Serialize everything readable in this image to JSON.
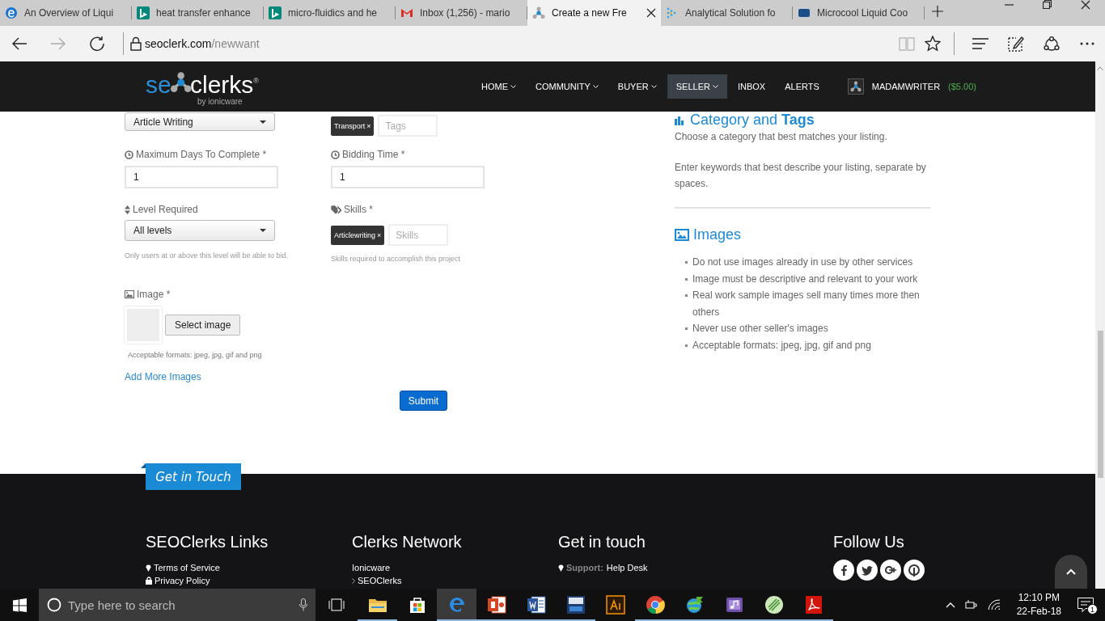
{
  "browser": {
    "tabs": [
      {
        "title": "An Overview of Liqui",
        "selected": false
      },
      {
        "title": "heat transfer enhance",
        "selected": false
      },
      {
        "title": "micro-fluidics and he",
        "selected": false
      },
      {
        "title": "Inbox (1,256) - mario",
        "selected": false
      },
      {
        "title": "Create a new Fre",
        "selected": true
      },
      {
        "title": "Analytical Solution fo",
        "selected": false
      },
      {
        "title": "Microcool Liquid Coo",
        "selected": false
      }
    ],
    "address": {
      "host": "seoclerk.com",
      "path": "/newwant"
    }
  },
  "site_nav": {
    "logo": {
      "lead": "se",
      "rest": "clerks",
      "mark": "®",
      "tagline": "by ionicware"
    },
    "items": [
      {
        "label": "HOME",
        "has_menu": true,
        "selected": false
      },
      {
        "label": "COMMUNITY",
        "has_menu": true,
        "selected": false
      },
      {
        "label": "BUYER",
        "has_menu": true,
        "selected": false
      },
      {
        "label": "SELLER",
        "has_menu": true,
        "selected": true
      },
      {
        "label": "INBOX",
        "has_menu": false,
        "selected": false
      },
      {
        "label": "ALERTS",
        "has_menu": false,
        "selected": false
      }
    ],
    "user": {
      "name": "MADAMWRITER",
      "balance": "($5.00)"
    }
  },
  "form": {
    "category": {
      "value": "Article Writing"
    },
    "tags": {
      "chips": [
        {
          "label": "Transport",
          "remove": "×"
        }
      ],
      "placeholder": "Tags"
    },
    "max_days": {
      "label": "Maximum Days To Complete *",
      "value": "1"
    },
    "bidding_time": {
      "label": "Bidding Time *",
      "value": "1"
    },
    "level": {
      "label": "Level Required",
      "value": "All levels",
      "help": "Only users at or above this level will be able to bid."
    },
    "skills": {
      "label": "Skills *",
      "chips": [
        {
          "label": "Articlewriting",
          "remove": "×"
        }
      ],
      "placeholder": "Skills",
      "help": "Skills required to accomplish this project"
    },
    "image": {
      "label": "Image *",
      "button": "Select image",
      "help": "Acceptable formats: jpeg, jpg, gif and png",
      "add_more": "Add More Images"
    },
    "submit": "Submit"
  },
  "sidebar": {
    "category_heading": "Category and **Tags**",
    "category_texts": [
      "Choose a category that best matches your listing.",
      "Enter keywords that best describe your listing, separate by spaces."
    ],
    "images_heading": "Images",
    "images_tips": [
      "Do not use images already in use by other services",
      "Image must be descriptive and relevant to your work",
      "Real work sample images sell many times more then others",
      "Never use other seller's images",
      "Acceptable formats: jpeg, jpg, gif and png"
    ]
  },
  "footer": {
    "ribbon": "Get in Touch",
    "columns": [
      {
        "heading": "SEOClerks Links",
        "links": [
          {
            "label": "Terms of Service"
          },
          {
            "label": "Privacy Policy"
          }
        ]
      },
      {
        "heading": "Clerks Network",
        "links": [
          {
            "label": "Ionicware"
          },
          {
            "label": "SEOClerks"
          }
        ]
      },
      {
        "heading": "Get in touch",
        "links": [
          {
            "prefix": "Support:",
            "label": "Help Desk"
          }
        ]
      },
      {
        "heading": "Follow Us"
      }
    ]
  },
  "taskbar": {
    "search_placeholder": "Type here to search",
    "apps": [
      {
        "kind": "folder",
        "running": true,
        "selected": false
      },
      {
        "kind": "store",
        "running": false,
        "selected": false
      },
      {
        "kind": "edge",
        "running": true,
        "selected": true
      },
      {
        "kind": "powerpoint",
        "running": true,
        "selected": false
      },
      {
        "kind": "word",
        "running": true,
        "selected": false
      },
      {
        "kind": "dev",
        "running": true,
        "selected": false
      },
      {
        "kind": "illustrator",
        "running": false,
        "selected": false
      },
      {
        "kind": "chrome",
        "running": true,
        "selected": false
      },
      {
        "kind": "globe",
        "running": true,
        "selected": false
      },
      {
        "kind": "music",
        "running": true,
        "selected": false
      },
      {
        "kind": "green",
        "running": true,
        "selected": false
      },
      {
        "kind": "acrobat",
        "running": true,
        "selected": false
      }
    ],
    "time": "12:10 PM",
    "date": "22-Feb-18",
    "notifications": "1"
  }
}
